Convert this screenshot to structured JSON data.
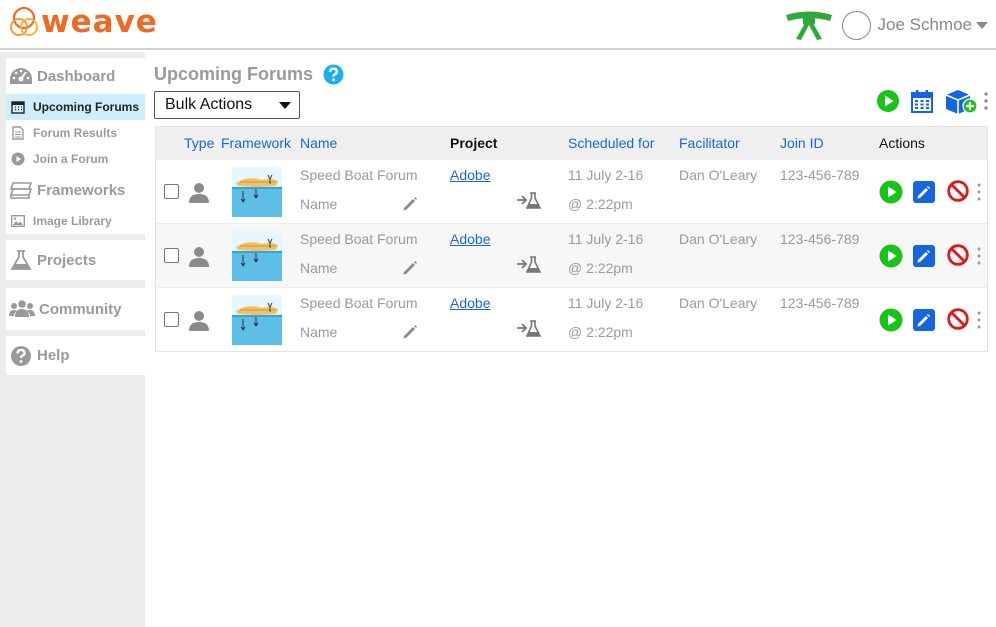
{
  "app": {
    "logo_text": "weave"
  },
  "user": {
    "name": "Joe Schmoe"
  },
  "sidebar": {
    "dashboard": {
      "label": "Dashboard",
      "items": [
        {
          "label": "Upcoming Forums",
          "active": true
        },
        {
          "label": "Forum Results"
        },
        {
          "label": "Join a Forum"
        }
      ]
    },
    "frameworks": {
      "label": "Frameworks",
      "items": [
        {
          "label": "Image Library"
        }
      ]
    },
    "projects": {
      "label": "Projects"
    },
    "community": {
      "label": "Community"
    },
    "help": {
      "label": "Help"
    }
  },
  "main": {
    "title": "Upcoming Forums",
    "bulk_actions": "Bulk Actions"
  },
  "table": {
    "columns": {
      "type": "Type",
      "framework": "Framework",
      "name": "Name",
      "project": "Project",
      "scheduled": "Scheduled for",
      "facilitator": "Facilitator",
      "join_id": "Join ID",
      "actions": "Actions"
    },
    "rows": [
      {
        "forum": "Speed Boat Forum",
        "name_placeholder": "Name",
        "project": "Adobe",
        "date": "11 July 2-16",
        "time": "@ 2:22pm",
        "facilitator": "Dan O'Leary",
        "join_id": "123-456-789"
      },
      {
        "forum": "Speed Boat Forum",
        "name_placeholder": "Name",
        "project": "Adobe",
        "date": "11 July 2-16",
        "time": "@ 2:22pm",
        "facilitator": "Dan O'Leary",
        "join_id": "123-456-789"
      },
      {
        "forum": "Speed Boat Forum",
        "name_placeholder": "Name",
        "project": "Adobe",
        "date": "11 July 2-16",
        "time": "@ 2:22pm",
        "facilitator": "Dan O'Leary",
        "join_id": "123-456-789"
      }
    ]
  },
  "colors": {
    "brand": "#ee6a24",
    "link": "#1a67d6",
    "play": "#19c419",
    "edit": "#1565e0",
    "cancel": "#e01919",
    "active_nav": "#cfeefb",
    "help": "#1ab0f0"
  },
  "icons": [
    "belt-icon",
    "help-icon",
    "play-icon",
    "calendar-icon",
    "add-box-icon",
    "more-vertical-icon",
    "user-icon",
    "pencil-icon",
    "assign-to-project-icon",
    "edit-icon",
    "cancel-icon"
  ]
}
